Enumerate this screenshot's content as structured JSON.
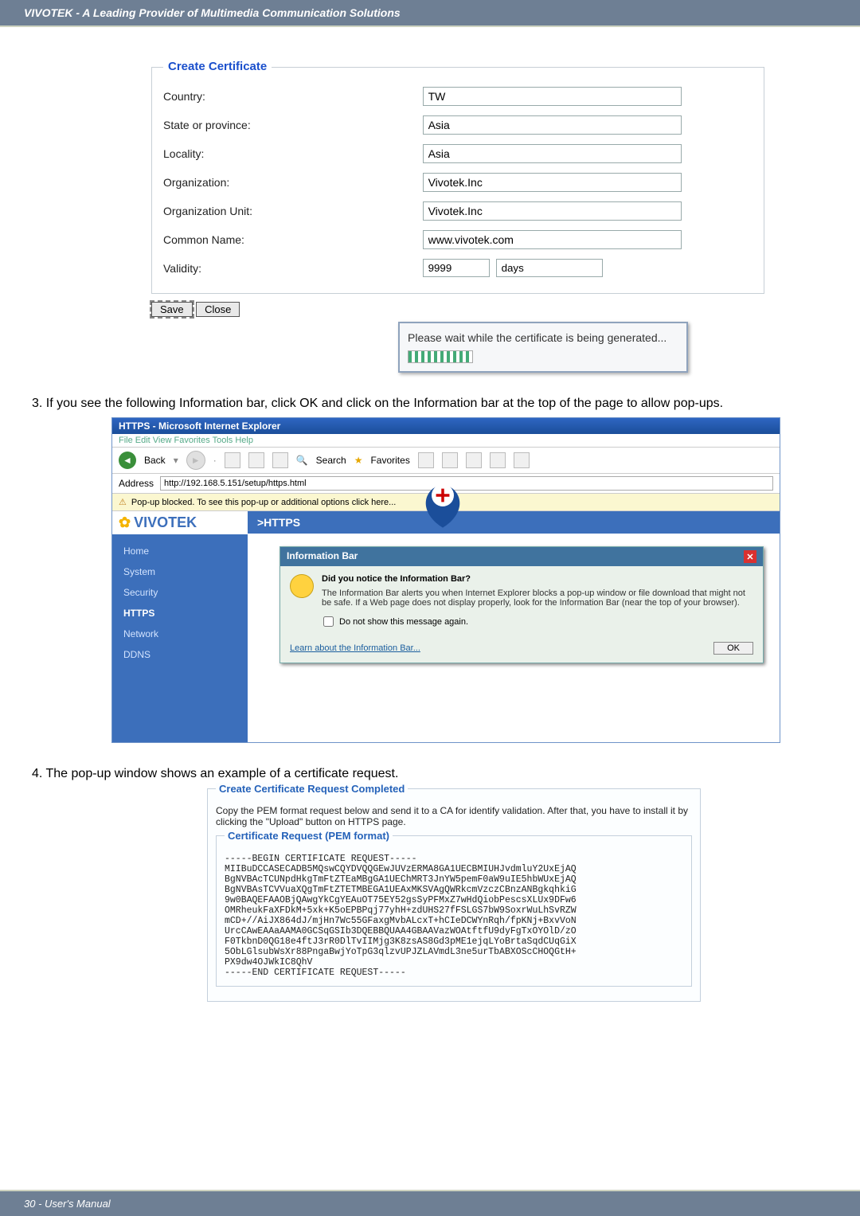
{
  "header_tagline": "VIVOTEK - A Leading Provider of Multimedia Communication Solutions",
  "footer_text": "30 - User's Manual",
  "cert_panel": {
    "legend": "Create Certificate",
    "fields": {
      "country_label": "Country:",
      "country_value": "TW",
      "state_label": "State or province:",
      "state_value": "Asia",
      "locality_label": "Locality:",
      "locality_value": "Asia",
      "org_label": "Organization:",
      "org_value": "Vivotek.Inc",
      "orgunit_label": "Organization Unit:",
      "orgunit_value": "Vivotek.Inc",
      "cn_label": "Common Name:",
      "cn_value": "www.vivotek.com",
      "validity_label": "Validity:",
      "validity_value": "9999",
      "validity_unit": "days"
    },
    "buttons": {
      "save": "Save",
      "close": "Close"
    },
    "msg": "Please wait while the certificate is being generated..."
  },
  "step3": "3. If you see the following Information bar, click OK and click on the Information bar at the top of the page to allow pop-ups.",
  "ie": {
    "title": "HTTPS - Microsoft Internet Explorer",
    "menus": "File  Edit  View  Favorites  Tools  Help",
    "toolbar": {
      "back_label": "Back",
      "search_label": "Search",
      "favorites_label": "Favorites"
    },
    "address_label": "Address",
    "address_value": "http://192.168.5.151/setup/https.html",
    "popup_bar": "Pop-up blocked. To see this pop-up or additional options click here...",
    "logo_text": "VIVOTEK",
    "page_tab": ">HTTPS",
    "sidebar": {
      "home": "Home",
      "system": "System",
      "security": "Security",
      "https": "HTTPS",
      "network": "Network",
      "ddns": "DDNS"
    },
    "infobar": {
      "title": "Information Bar",
      "q": "Did you notice the Information Bar?",
      "desc": "The Information Bar alerts you when Internet Explorer blocks a pop-up window or file download that might not be safe. If a Web page does not display properly, look for the Information Bar (near the top of your browser).",
      "chk_label": "Do not show this message again.",
      "learn": "Learn about the Information Bar...",
      "ok": "OK"
    }
  },
  "step4": "4. The pop-up window shows an example of a certificate request.",
  "pem": {
    "legend_outer": "Create Certificate Request Completed",
    "note": "Copy the PEM format request below and send it to a CA for identify validation. After that, you have to install it by clicking the \"Upload\" button on HTTPS page.",
    "legend_inner": "Certificate Request (PEM format)",
    "body": "-----BEGIN CERTIFICATE REQUEST-----\nMIIBuDCCASECADB5MQswCQYDVQQGEwJUVzERMA8GA1UECBMIUHJvdmluY2UxEjAQ\nBgNVBAcTCUNpdHkgTmFtZTEaMBgGA1UEChMRT3JnYW5pemF0aW9uIE5hbWUxEjAQ\nBgNVBAsTCVVuaXQgTmFtZTETMBEGA1UEAxMKSVAgQWRkcmVzczCBnzANBgkqhkiG\n9w0BAQEFAAOBjQAwgYkCgYEAuOT75EY52gsSyPFMxZ7wHdQiobPescsXLUx9DFw6\nOMRheukFaXFDkM+5xk+K5oEPBPqj77yhH+zdUHS27fFSLGS7bW9SoxrWuLhSvRZW\nmCD+//AiJX864dJ/mjHn7Wc55GFaxgMvbALcxT+hCIeDCWYnRqh/fpKNj+BxvVoN\nUrcCAwEAAaAAMA0GCSqGSIb3DQEBBQUAA4GBAAVazWOAtftfU9dyFgTxOYOlD/zO\nF0TkbnD0QG18e4ftJ3rR0DlTvIIMjg3K8zsAS8Gd3pME1ejqLYoBrtaSqdCUqGiX\n5ObLGlsubWsXr88PngaBwjYoTpG3qlzvUPJZLAVmdL3ne5urTbABXOScCHOQGtH+\nPX9dw4OJWkIC8QhV\n-----END CERTIFICATE REQUEST-----"
  }
}
